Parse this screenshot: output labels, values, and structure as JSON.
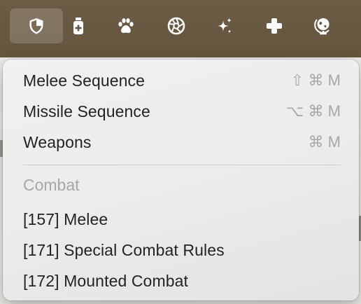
{
  "toolbar": {
    "buttons": [
      {
        "icon": "shield-icon",
        "active": true
      },
      {
        "icon": "potion-bottle-icon",
        "active": false
      },
      {
        "icon": "paw-icon",
        "active": false
      },
      {
        "icon": "aperture-icon",
        "active": false
      },
      {
        "icon": "sparkles-icon",
        "active": false
      },
      {
        "icon": "plus-icon",
        "active": false
      },
      {
        "icon": "globe-icon",
        "active": false
      }
    ],
    "background_color": "#6a5a43"
  },
  "menu": {
    "commands": [
      {
        "label": "Melee Sequence",
        "shortcut": [
          "⇧",
          "⌘",
          "M"
        ]
      },
      {
        "label": "Missile Sequence",
        "shortcut": [
          "⌥",
          "⌘",
          "M"
        ]
      },
      {
        "label": "Weapons",
        "shortcut": [
          "⌘",
          "M"
        ]
      }
    ],
    "section_title": "Combat",
    "section_items": [
      {
        "label": "[157] Melee"
      },
      {
        "label": "[171] Special Combat Rules"
      },
      {
        "label": "[172] Mounted Combat"
      }
    ]
  }
}
